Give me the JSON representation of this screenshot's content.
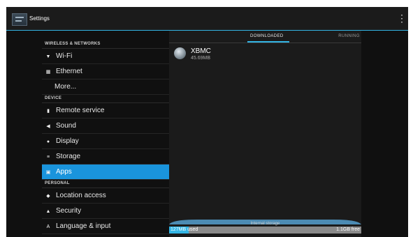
{
  "action_bar": {
    "title": "Settings",
    "overflow_glyph": "⋮"
  },
  "sidebar": {
    "sections": [
      {
        "header": "WIRELESS & NETWORKS",
        "items": [
          {
            "icon": "wifi-icon",
            "glyph": "▼",
            "label": "Wi-Fi"
          },
          {
            "icon": "ethernet-icon",
            "glyph": "▦",
            "label": "Ethernet"
          },
          {
            "icon": "",
            "glyph": "",
            "label": "More..."
          }
        ]
      },
      {
        "header": "DEVICE",
        "items": [
          {
            "icon": "remote-icon",
            "glyph": "▮",
            "label": "Remote service"
          },
          {
            "icon": "sound-icon",
            "glyph": "◀",
            "label": "Sound"
          },
          {
            "icon": "display-icon",
            "glyph": "●",
            "label": "Display"
          },
          {
            "icon": "storage-icon",
            "glyph": "≡",
            "label": "Storage"
          },
          {
            "icon": "apps-icon",
            "glyph": "▣",
            "label": "Apps"
          }
        ]
      },
      {
        "header": "PERSONAL",
        "items": [
          {
            "icon": "location-icon",
            "glyph": "◆",
            "label": "Location access"
          },
          {
            "icon": "lock-icon",
            "glyph": "▲",
            "label": "Security"
          },
          {
            "icon": "keyboard-icon",
            "glyph": "A",
            "label": "Language & input"
          }
        ]
      }
    ],
    "selected": "Apps"
  },
  "tabs": {
    "downloaded": "DOWNLOADED",
    "running": "RUNNING"
  },
  "apps": [
    {
      "name": "XBMC",
      "size": "45.69MB"
    }
  ],
  "storage": {
    "label": "Internal storage",
    "used": "127MB used",
    "free": "1.1GB free",
    "used_fraction": 0.1
  },
  "colors": {
    "accent": "#33b5e5",
    "selected": "#1a94dc"
  }
}
